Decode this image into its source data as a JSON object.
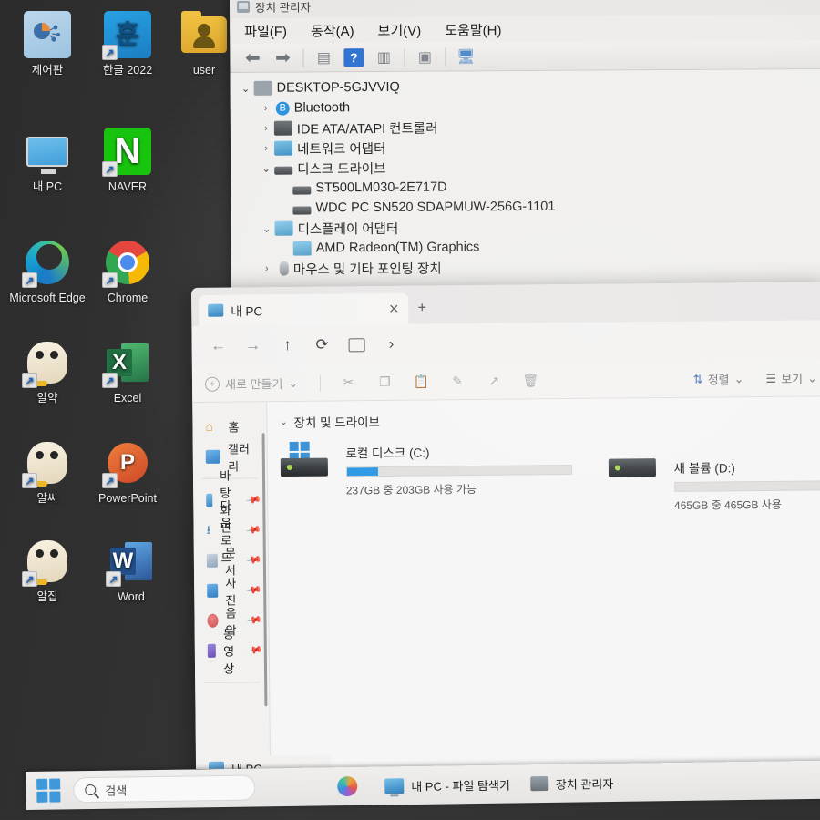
{
  "desktop": {
    "icons": [
      {
        "label": "제어판",
        "icon": "control-panel-icon",
        "shortcut": false
      },
      {
        "label": "한글 2022",
        "icon": "hangul-2022-icon",
        "shortcut": true
      },
      {
        "label": "user",
        "icon": "user-folder-icon",
        "shortcut": false
      },
      {
        "label": "내 PC",
        "icon": "my-pc-icon",
        "shortcut": false
      },
      {
        "label": "NAVER",
        "icon": "naver-icon",
        "shortcut": true
      },
      {
        "label": "Microsoft Edge",
        "icon": "edge-icon",
        "shortcut": true
      },
      {
        "label": "Chrome",
        "icon": "chrome-icon",
        "shortcut": true
      },
      {
        "label": "알약",
        "icon": "alyac-icon",
        "shortcut": true
      },
      {
        "label": "Excel",
        "icon": "excel-icon",
        "shortcut": true
      },
      {
        "label": "알씨",
        "icon": "alsee-icon",
        "shortcut": true
      },
      {
        "label": "PowerPoint",
        "icon": "powerpoint-icon",
        "shortcut": true
      },
      {
        "label": "알집",
        "icon": "alzip-icon",
        "shortcut": true
      },
      {
        "label": "Word",
        "icon": "word-icon",
        "shortcut": true
      }
    ]
  },
  "device_manager": {
    "title": "장치 관리자",
    "menu": [
      "파일(F)",
      "동작(A)",
      "보기(V)",
      "도움말(H)"
    ],
    "toolbar": [
      "back-arrow",
      "forward-arrow",
      "properties",
      "help",
      "update-driver",
      "uninstall-device",
      "scan-hardware"
    ],
    "tree": [
      {
        "label": "DESKTOP-5GJVVIQ",
        "indent": 0,
        "chevron": "open",
        "icon": "computer-icon"
      },
      {
        "label": "Bluetooth",
        "indent": 1,
        "chevron": "closed",
        "icon": "bluetooth-icon"
      },
      {
        "label": "IDE ATA/ATAPI 컨트롤러",
        "indent": 1,
        "chevron": "closed",
        "icon": "ide-controller-icon"
      },
      {
        "label": "네트워크 어댑터",
        "indent": 1,
        "chevron": "closed",
        "icon": "network-adapter-icon"
      },
      {
        "label": "디스크 드라이브",
        "indent": 1,
        "chevron": "open",
        "icon": "disk-drive-icon"
      },
      {
        "label": "ST500LM030-2E717D",
        "indent": 2,
        "chevron": "none",
        "icon": "disk-drive-icon"
      },
      {
        "label": "WDC PC SN520 SDAPMUW-256G-1101",
        "indent": 2,
        "chevron": "none",
        "icon": "disk-drive-icon"
      },
      {
        "label": "디스플레이 어댑터",
        "indent": 1,
        "chevron": "open",
        "icon": "display-adapter-icon"
      },
      {
        "label": "AMD Radeon(TM) Graphics",
        "indent": 2,
        "chevron": "none",
        "icon": "display-adapter-icon"
      },
      {
        "label": "마우스 및 기타 포인팅 장치",
        "indent": 1,
        "chevron": "closed",
        "icon": "mouse-icon"
      }
    ]
  },
  "explorer": {
    "tab": {
      "label": "내 PC",
      "close": "✕"
    },
    "new_tab": "+",
    "nav": {
      "back": "←",
      "forward": "→",
      "up": "↑",
      "refresh": "⟳",
      "breadcrumb_chevron": "›"
    },
    "toolbar": {
      "new_label": "새로 만들기",
      "new_caret": "⌄",
      "sort_label": "정렬",
      "sort_caret": "⌄",
      "view_label": "보기",
      "view_caret": "⌄",
      "icons": [
        "cut-icon",
        "copy-icon",
        "paste-icon",
        "rename-icon",
        "share-icon",
        "delete-icon"
      ]
    },
    "sidebar": [
      {
        "label": "홈",
        "icon": "home-icon",
        "pin": false
      },
      {
        "label": "갤러리",
        "icon": "gallery-icon",
        "pin": false
      },
      {
        "label": "바탕 화면",
        "icon": "desktop-icon",
        "pin": true
      },
      {
        "label": "다운로드",
        "icon": "downloads-icon",
        "pin": true
      },
      {
        "label": "문서",
        "icon": "documents-icon",
        "pin": true
      },
      {
        "label": "사진",
        "icon": "pictures-icon",
        "pin": true
      },
      {
        "label": "음악",
        "icon": "music-icon",
        "pin": true
      },
      {
        "label": "동영상",
        "icon": "videos-icon",
        "pin": true
      }
    ],
    "sidebar_bottom": {
      "label": "내 PC",
      "icon": "my-pc-icon"
    },
    "group_header": "장치 및 드라이브",
    "group_chevron": "⌄",
    "drives": [
      {
        "name": "로컬 디스크 (C:)",
        "sub": "237GB 중 203GB 사용 가능",
        "used_percent": 14,
        "bar_color": "#2196e8",
        "has_windows_logo": true
      },
      {
        "name": "새 볼륨 (D:)",
        "sub": "465GB 중 465GB 사용",
        "used_percent": 0,
        "bar_color": "#2196e8",
        "has_windows_logo": false
      }
    ]
  },
  "taskbar": {
    "search_placeholder": "검색",
    "items": [
      {
        "label": "",
        "icon": "copilot-icon"
      },
      {
        "label": "내 PC - 파일 탐색기",
        "icon": "file-explorer-icon"
      },
      {
        "label": "장치 관리자",
        "icon": "device-manager-icon"
      }
    ]
  }
}
